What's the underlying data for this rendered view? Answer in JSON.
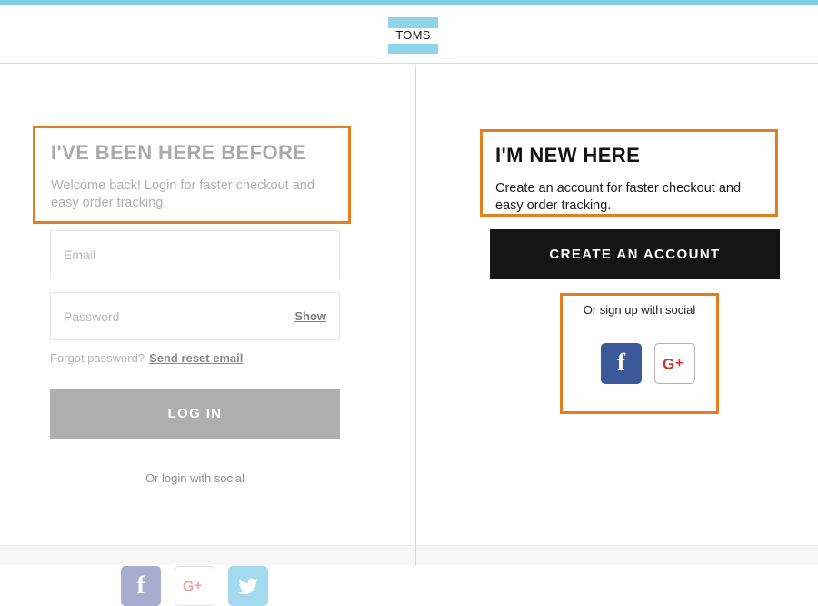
{
  "header": {
    "accent_color": "#7ecde4",
    "logo": {
      "wordmark": "TOMS",
      "icon": "toms-logo"
    }
  },
  "annotation": {
    "highlight_color": "#e2801f"
  },
  "left_panel": {
    "title": "I'VE BEEN HERE BEFORE",
    "subtitle": "Welcome back! Login for faster checkout and easy order tracking.",
    "email_field": {
      "placeholder": "Email",
      "value": ""
    },
    "password_field": {
      "placeholder": "Password",
      "value": "",
      "show_label": "Show"
    },
    "forgot": {
      "prompt": "Forgot password?",
      "link_label": "Send reset email"
    },
    "login_button": {
      "label": "LOG IN",
      "color": "#aeaeae",
      "disabled": true
    },
    "social": {
      "caption": "Or login with social",
      "buttons": [
        {
          "name": "facebook",
          "glyph": "f",
          "background": "#a6adcf"
        },
        {
          "name": "google-plus",
          "glyph": "G+",
          "background": "#ffffff"
        },
        {
          "name": "twitter",
          "glyph": "twitter-bird",
          "background": "#a4daf0"
        }
      ]
    }
  },
  "right_panel": {
    "title": "I'M NEW HERE",
    "subtitle": "Create an account for faster checkout and easy order tracking.",
    "create_button": {
      "label": "CREATE AN ACCOUNT",
      "color": "#151515"
    },
    "social": {
      "caption": "Or sign up with social",
      "buttons": [
        {
          "name": "facebook",
          "glyph": "f",
          "background": "#3b5998"
        },
        {
          "name": "google-plus",
          "glyph": "G+",
          "background": "#ffffff"
        }
      ]
    }
  }
}
